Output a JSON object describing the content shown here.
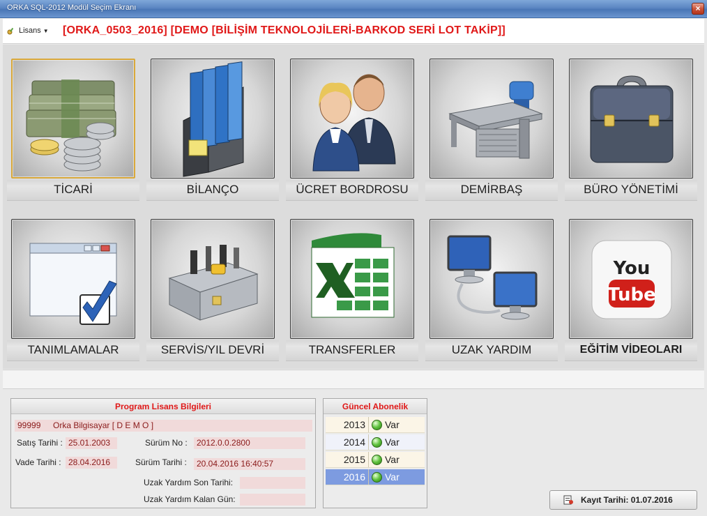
{
  "window": {
    "title": "ORKA SQL-2012  Modül Seçim Ekranı",
    "close_label": "×"
  },
  "header": {
    "lisans_label": "Lisans",
    "title": "[ORKA_0503_2016] [DEMO [BİLİŞİM TEKNOLOJİLERİ-BARKOD SERİ LOT TAKİP]]"
  },
  "modules": {
    "row1": [
      {
        "label": "TİCARİ",
        "icon": "money-icon"
      },
      {
        "label": "BİLANÇO",
        "icon": "binders-icon"
      },
      {
        "label": "ÜCRET BORDROSU",
        "icon": "people-icon"
      },
      {
        "label": "DEMİRBAŞ",
        "icon": "desk-icon"
      },
      {
        "label": "BÜRO YÖNETİMİ",
        "icon": "briefcase-icon"
      }
    ],
    "row2": [
      {
        "label": "TANIMLAMALAR",
        "icon": "window-check-icon"
      },
      {
        "label": "SERVİS/YIL DEVRİ",
        "icon": "toolbox-icon"
      },
      {
        "label": "TRANSFERLER",
        "icon": "excel-icon"
      },
      {
        "label": "UZAK YARDIM",
        "icon": "remote-computers-icon"
      },
      {
        "label": "EĞİTİM VİDEOLARI",
        "icon": "youtube-icon",
        "icon_text_top": "You",
        "icon_text_bottom": "Tube"
      }
    ]
  },
  "license_panel": {
    "title": "Program Lisans Bilgileri",
    "code": "99999",
    "company": "Orka Bilgisayar [ D E M O ]",
    "satis_label": "Satış Tarihi :",
    "satis_value": "25.01.2003",
    "surum_label": "Sürüm No :",
    "surum_value": "2012.0.0.2800",
    "vade_label": "Vade Tarihi :",
    "vade_value": "28.04.2016",
    "surum_tarihi_label": "Sürüm Tarihi :",
    "surum_tarihi_value": "20.04.2016 16:40:57",
    "uzak_son_label": "Uzak Yardım Son Tarihi:",
    "uzak_son_value": "",
    "uzak_kalan_label": "Uzak Yardım Kalan Gün:",
    "uzak_kalan_value": ""
  },
  "subscription_panel": {
    "title": "Güncel Abonelik",
    "rows": [
      {
        "year": "2013",
        "status": "Var"
      },
      {
        "year": "2014",
        "status": "Var"
      },
      {
        "year": "2015",
        "status": "Var"
      },
      {
        "year": "2016",
        "status": "Var"
      }
    ]
  },
  "footer": {
    "kayit_label": "Kayıt Tarihi: 01.07.2016"
  },
  "colors": {
    "accent_red": "#e01818",
    "titlebar_blue": "#5b86c2",
    "selection_blue": "#7d9be0",
    "status_green": "#5fc23e"
  }
}
